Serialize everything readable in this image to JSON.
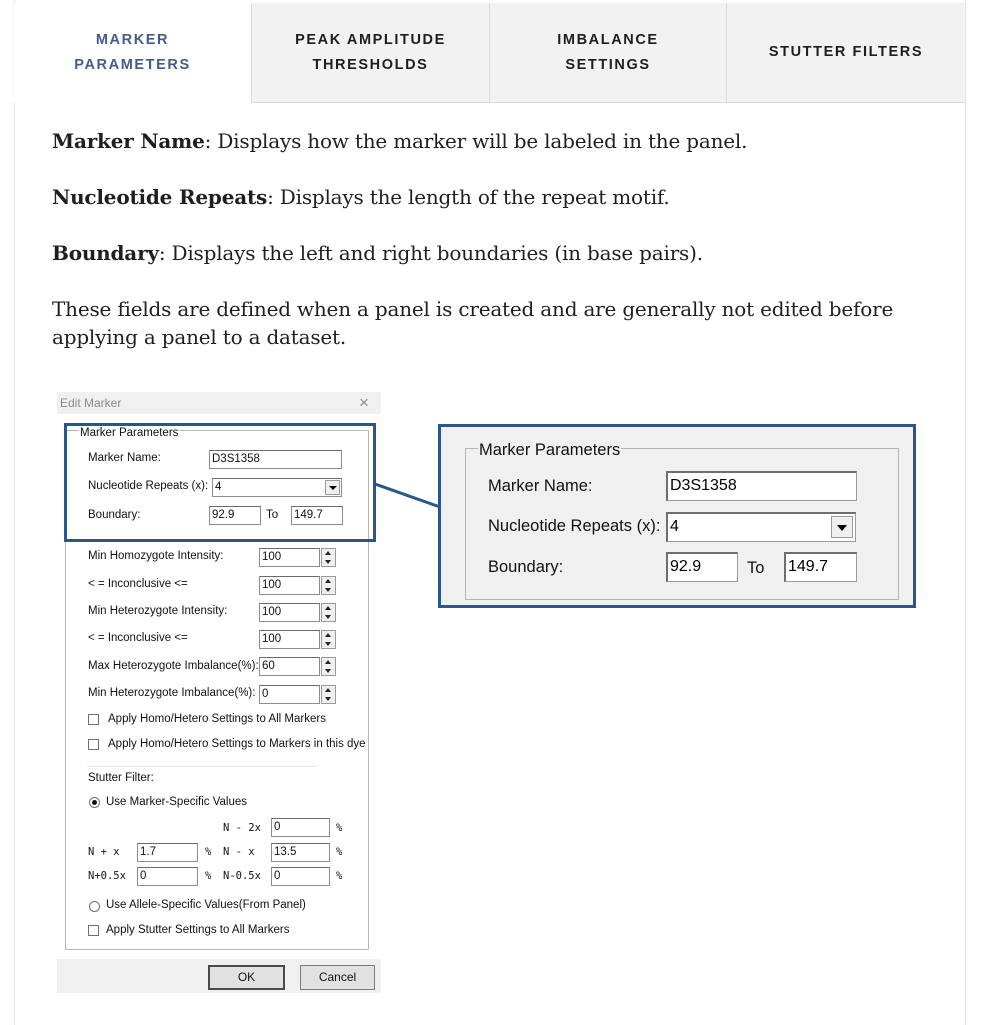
{
  "tabs": [
    {
      "label": "MARKER\nPARAMETERS",
      "active": true
    },
    {
      "label": "PEAK AMPLITUDE\nTHRESHOLDS",
      "active": false
    },
    {
      "label": "IMBALANCE\nSETTINGS",
      "active": false
    },
    {
      "label": "STUTTER FILTERS",
      "active": false
    }
  ],
  "content": {
    "marker_name_term": "Marker Name",
    "marker_name_desc": ": Displays how the marker will be labeled in the panel.",
    "nucleotide_term": "Nucleotide Repeats",
    "nucleotide_desc": ": Displays the length of the repeat motif.",
    "boundary_term": "Boundary",
    "boundary_desc": ": Displays the left and right boundaries (in base pairs).",
    "note": "These fields are defined when a panel is created and are generally not edited before applying a panel to a dataset."
  },
  "dialog": {
    "title": "Edit Marker",
    "close": "×",
    "group_title": "Marker Parameters",
    "marker_name_label": "Marker Name:",
    "marker_name_value": "D3S1358",
    "repeats_label": "Nucleotide Repeats (x):",
    "repeats_value": "4",
    "boundary_label": "Boundary:",
    "boundary_from": "92.9",
    "to_label": "To",
    "boundary_to": "149.7",
    "min_homo_label": "Min Homozygote Intensity:",
    "min_homo_value": "100",
    "inconclusive1_label": "< = Inconclusive <=",
    "inconclusive1_value": "100",
    "min_hetero_label": "Min Heterozygote Intensity:",
    "min_hetero_value": "100",
    "inconclusive2_label": "< = Inconclusive <=",
    "inconclusive2_value": "100",
    "max_imbalance_label": "Max Heterozygote Imbalance(%):",
    "max_imbalance_value": "60",
    "min_imbalance_label": "Min Heterozygote Imbalance(%):",
    "min_imbalance_value": "0",
    "apply_all_label": "Apply Homo/Hetero Settings to All Markers",
    "apply_dye_label": "Apply Homo/Hetero Settings to Markers in this dye",
    "stutter_label": "Stutter Filter:",
    "marker_specific_label": "Use Marker-Specific Values",
    "n_minus_2x_label": "N - 2x",
    "n_minus_2x_value": "0",
    "n_plus_x_label": "N + x",
    "n_plus_x_value": "1.7",
    "n_minus_x_label": "N - x",
    "n_minus_x_value": "13.5",
    "n_plus_half_label": "N+0.5x",
    "n_plus_half_value": "0",
    "n_minus_half_label": "N-0.5x",
    "n_minus_half_value": "0",
    "percent": "%",
    "allele_specific_label": "Use Allele-Specific Values(From Panel)",
    "apply_stutter_label": "Apply Stutter Settings to All Markers",
    "ok_label": "OK",
    "cancel_label": "Cancel"
  },
  "zoom": {
    "group_title": "Marker Parameters",
    "marker_name_label": "Marker Name:",
    "marker_name_value": "D3S1358",
    "repeats_label": "Nucleotide Repeats (x):",
    "repeats_value": "4",
    "boundary_label": "Boundary:",
    "boundary_from": "92.9",
    "to_label": "To",
    "boundary_to": "149.7"
  },
  "colors": {
    "accent": "#3f5e8c",
    "highlight": "#2b5685"
  }
}
